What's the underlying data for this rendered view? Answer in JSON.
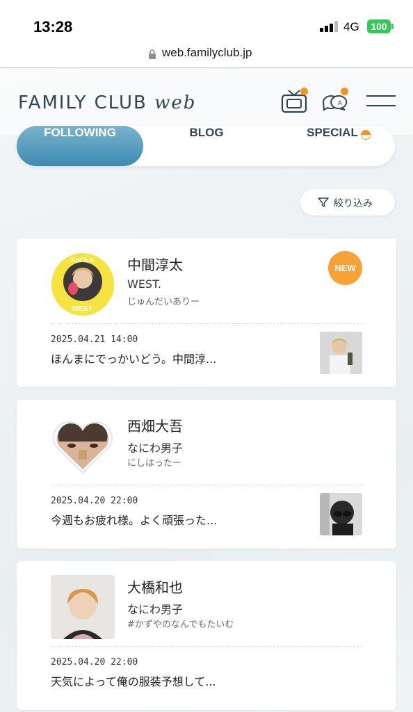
{
  "status_bar": {
    "time": "13:28",
    "network": "4G",
    "battery": "100"
  },
  "browser": {
    "url": "web.familyclub.jp"
  },
  "header": {
    "logo_main": "FAMILY CLUB",
    "logo_sub": "web"
  },
  "tabs": [
    {
      "label": "FOLLOWING",
      "active": true
    },
    {
      "label": "BLOG",
      "active": false
    },
    {
      "label": "SPECIAL",
      "active": false
    }
  ],
  "filter": {
    "label": "絞り込み"
  },
  "cards": [
    {
      "name": "中間淳太",
      "group": "WEST.",
      "handle": "じゅんだいありー",
      "badge": "NEW",
      "date": "2025.04.21 14:00",
      "excerpt": "ほんまにでっかいどう。中間淳...",
      "avatar_text": "JUNTA N.",
      "avatar_text2": "WEST."
    },
    {
      "name": "西畑大吾",
      "group": "なにわ男子",
      "handle": "にしはったー",
      "date": "2025.04.20 22:00",
      "excerpt": "今週もお疲れ様。よく頑張った..."
    },
    {
      "name": "大橋和也",
      "group": "なにわ男子",
      "handle": "#かずやのなんでもたいむ",
      "date": "2025.04.20 22:00",
      "excerpt": "天気によって俺の服装予想して..."
    }
  ],
  "colors": {
    "accent": "#3f8ab0",
    "badge": "#f7a236",
    "dot": "#f7941d",
    "battery": "#34c759"
  },
  "icons": [
    "lock-icon",
    "tv-icon",
    "chat-icon",
    "menu-icon",
    "filter-icon"
  ]
}
